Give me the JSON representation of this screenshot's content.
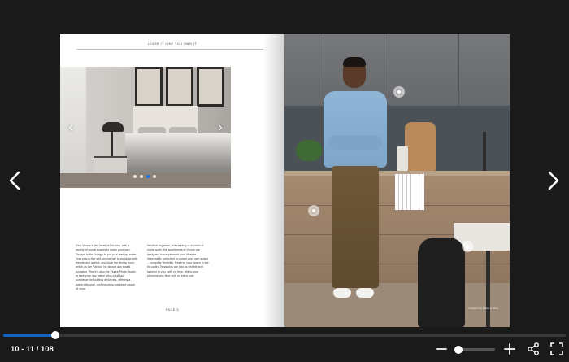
{
  "document": {
    "running_head": "LEASE IT LIKE YOU OWN IT",
    "folio": "PAGE 3",
    "body_col_1": "Club Venue is the heart of the new, with a variety of social spaces to make your own. Escape to the lounge to put your feet up, make your way to the self-service bar to socialise with friends and guests, and book the dining room, which as the Parlour, for almost any social occasion. There's also the Figure Pilots Studio to take your day active, plus a full tour concierge for building deliveries, offering a warm welcome, and ensuring complete peace of mind.",
    "body_col_2": "Whether together, entertaining or in need of some quiet, the apartments at Venue are designed to complement your lifestyle – impeccably furnished or curate your own space – complete flexibility. Reserve your space in the be united Tenancies are just as flexible and tailored to you, with no fees, letting your personal any time with no extra cost.",
    "photo_credit": "Lifestyle in the kitchen at Venue"
  },
  "carousel": {
    "prev_symbol": "‹",
    "next_symbol": "›",
    "slide_count": 4,
    "active_slide": 3,
    "active_color": "#1a73e8"
  },
  "navigation": {
    "prev_page_icon": "chevron-left-icon",
    "next_page_icon": "chevron-right-icon"
  },
  "progress": {
    "fraction": 0.093,
    "fill_color": "#1565c0"
  },
  "footer": {
    "page_counter": "10 - 11 / 108",
    "zoom_fraction": 0.1,
    "icons": [
      "minus-icon",
      "plus-icon",
      "share-icon",
      "fullscreen-icon"
    ]
  }
}
